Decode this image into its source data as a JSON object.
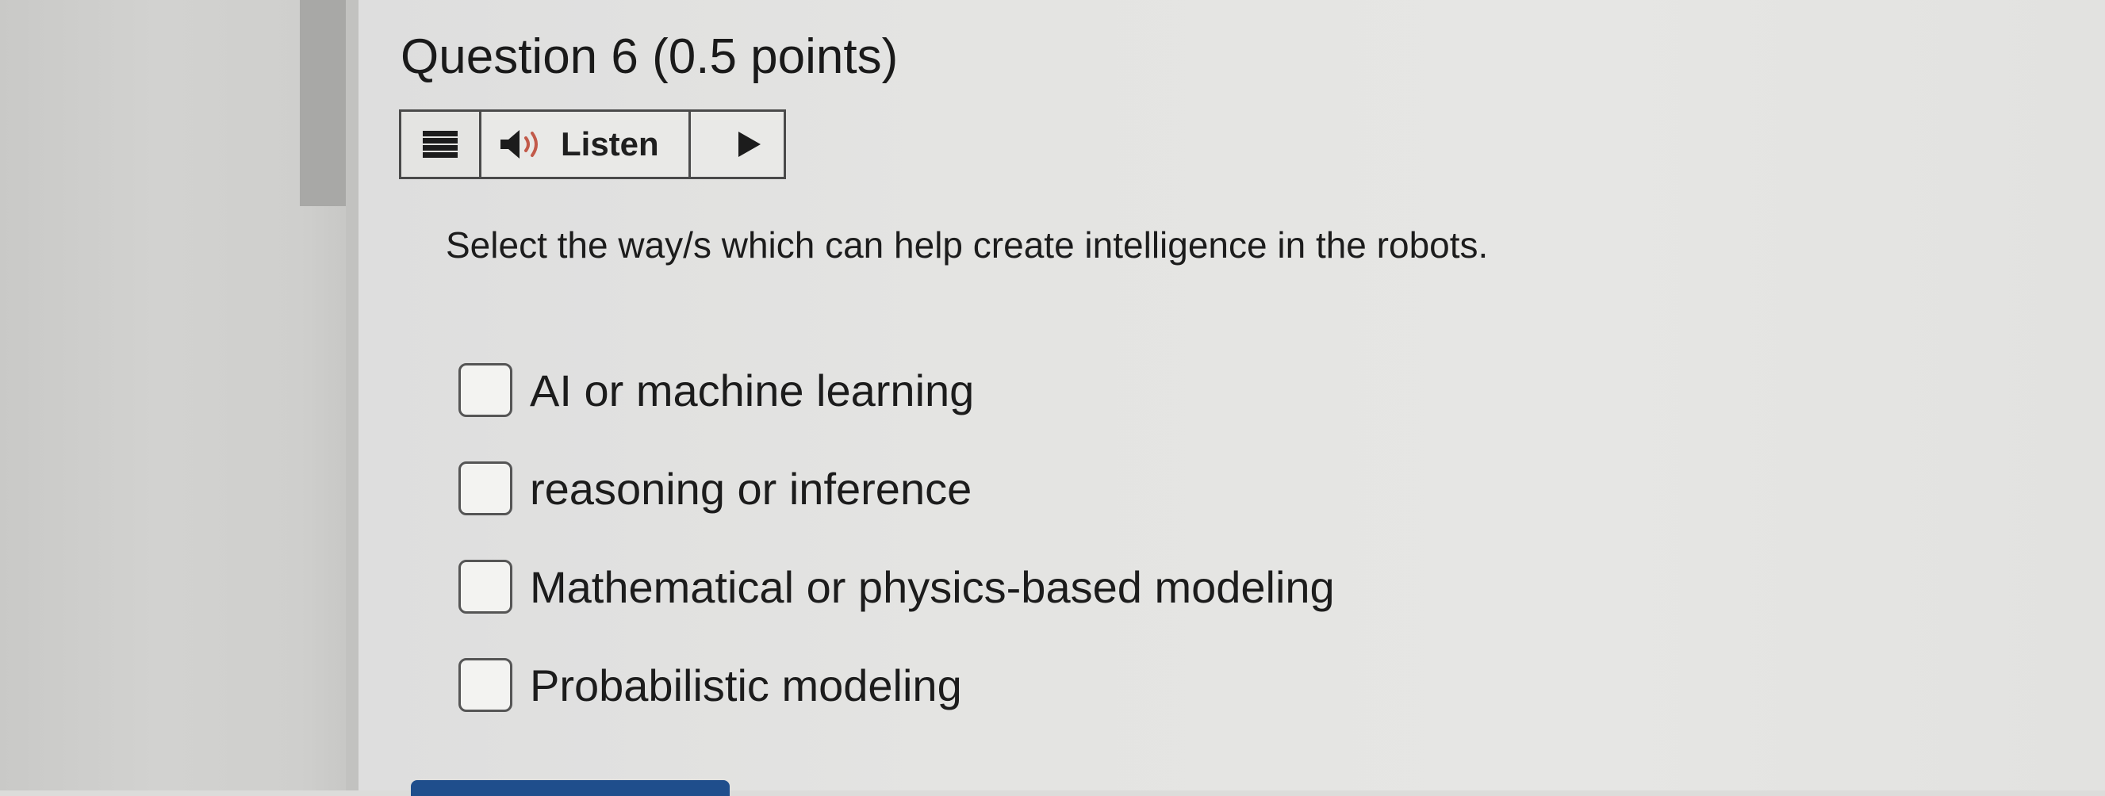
{
  "question": {
    "title": "Question 6 (0.5 points)",
    "prompt": "Select the way/s which can help create intelligence in the robots."
  },
  "toolbar": {
    "menu_icon": "menu-icon",
    "speaker_icon": "speaker-icon",
    "listen_label": "Listen",
    "play_icon": "play-icon"
  },
  "options": [
    {
      "label": "AI or machine learning",
      "checked": false
    },
    {
      "label": "reasoning or inference",
      "checked": false
    },
    {
      "label": "Mathematical or physics-based modeling",
      "checked": false
    },
    {
      "label": "Probabilistic modeling",
      "checked": false
    }
  ],
  "colors": {
    "button_primary": "#1f4e8c",
    "text": "#1c1c1c",
    "border": "#4a4a4a"
  }
}
